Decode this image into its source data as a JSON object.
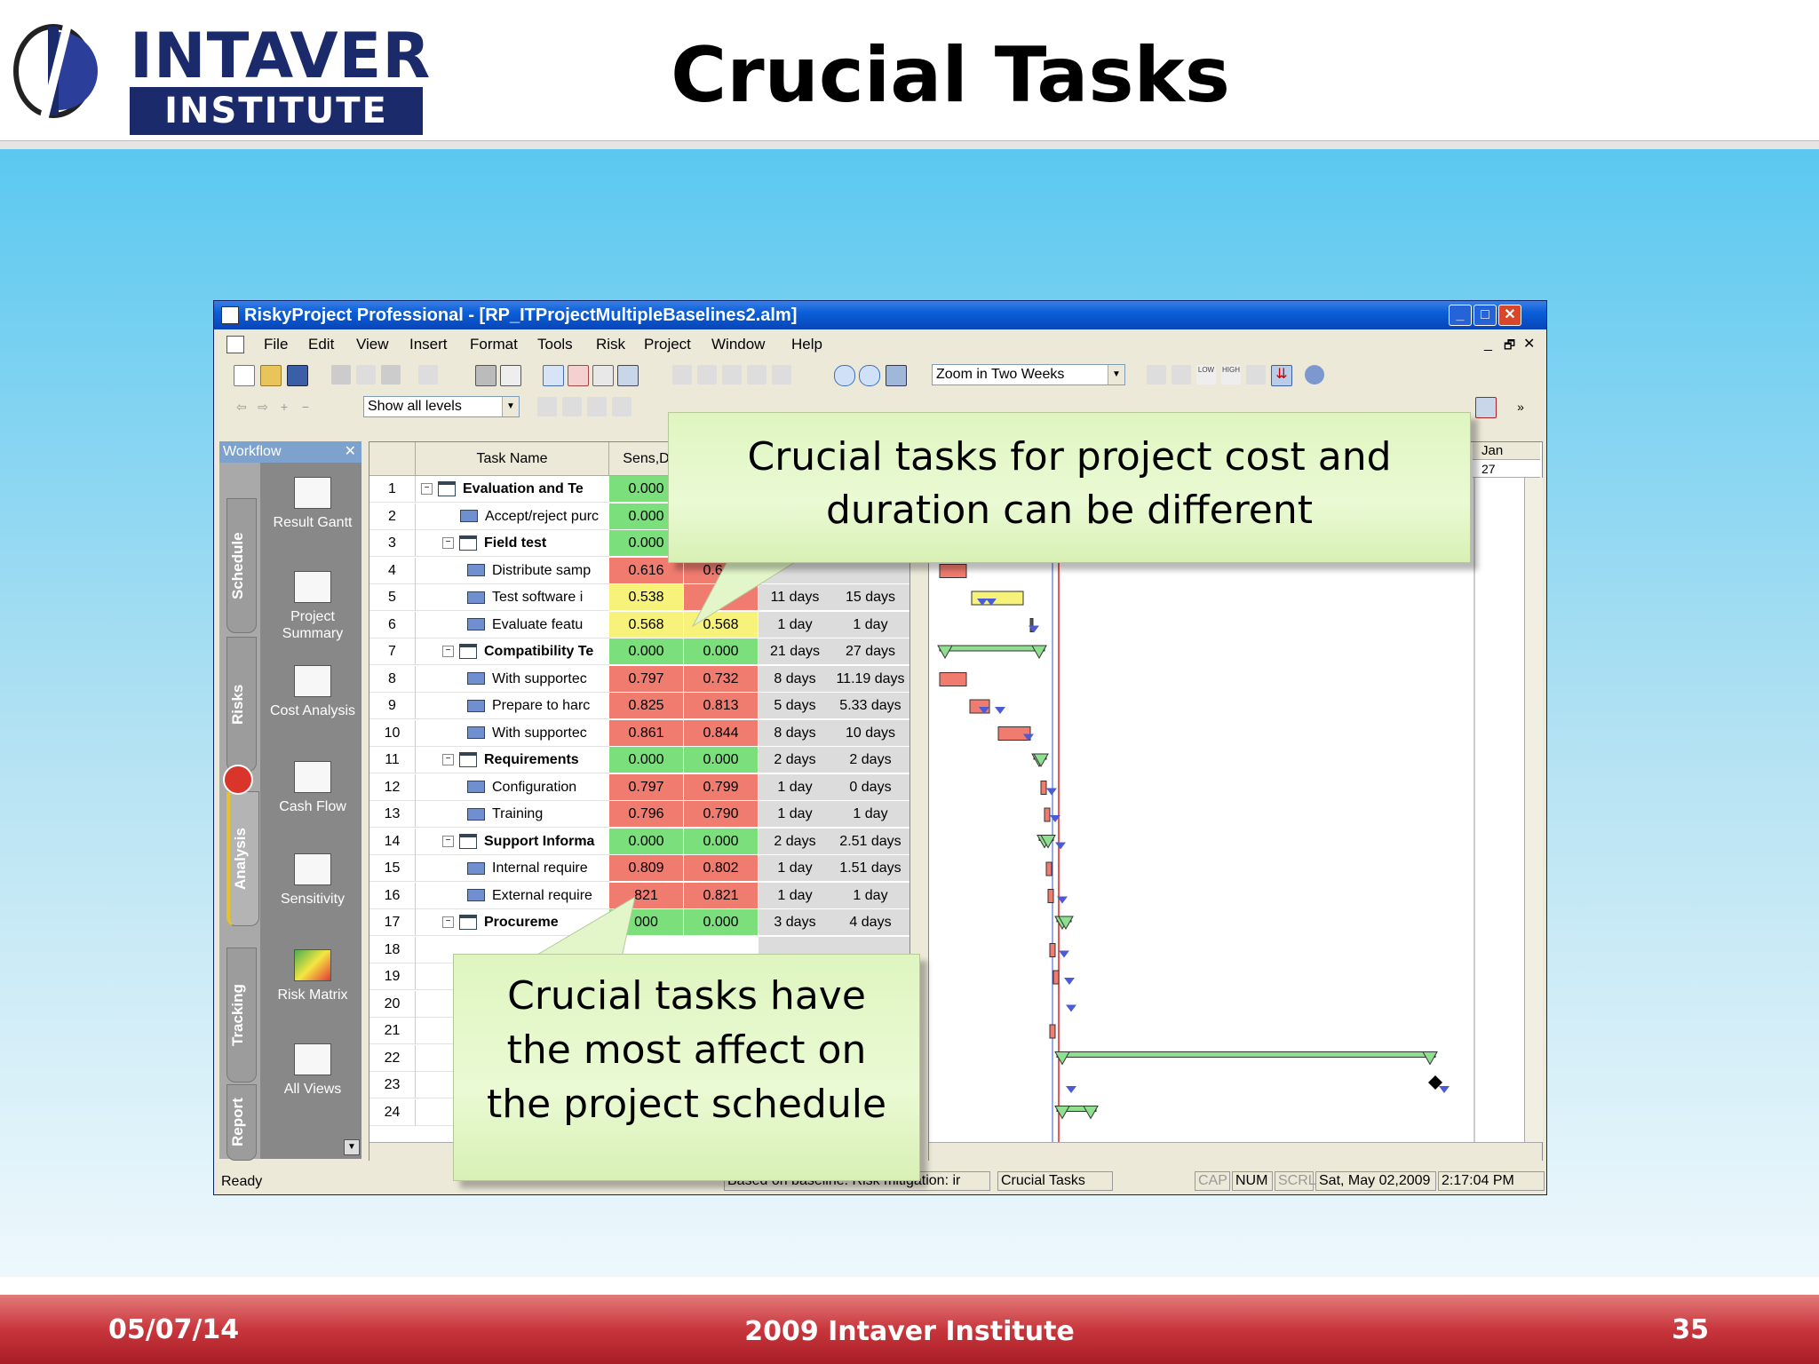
{
  "slide": {
    "logo_line1": "INTAVER",
    "logo_line2": "INSTITUTE",
    "title": "Crucial Tasks",
    "footer_date": "05/07/14",
    "footer_center": "2009 Intaver Institute",
    "page_number": "35"
  },
  "window": {
    "title": "RiskyProject Professional - [RP_ITProjectMultipleBaselines2.alm]",
    "menu": [
      "File",
      "Edit",
      "View",
      "Insert",
      "Format",
      "Tools",
      "Risk",
      "Project",
      "Window",
      "Help"
    ],
    "zoom_select": "Zoom in Two Weeks",
    "levels_select": "Show all levels",
    "status_ready": "Ready",
    "status_baseline": "Based on baseline.  Risk mitigation: ir",
    "status_view": "Crucial Tasks",
    "status_cap": "CAP",
    "status_num": "NUM",
    "status_scrl": "SCRL",
    "status_date": "Sat, May 02,2009",
    "status_time": "2:17:04 PM"
  },
  "workflow": {
    "header": "Workflow",
    "tabs": [
      "Schedule",
      "Risks",
      "Analysis",
      "Tracking",
      "Report"
    ],
    "items": [
      "Result Gantt",
      "Project Summary",
      "Cost Analysis",
      "Cash Flow",
      "Sensitivity",
      "Risk Matrix",
      "All Views"
    ]
  },
  "grid": {
    "col_name": "Task Name",
    "col_sens": "Sens,D",
    "rows": [
      {
        "id": "1",
        "name": "Evaluation and Te",
        "v1": "0.000",
        "v2": "",
        "d1": "",
        "d2": ""
      },
      {
        "id": "2",
        "name": "Accept/reject purc",
        "v1": "0.000",
        "v2": "",
        "d1": "",
        "d2": ""
      },
      {
        "id": "3",
        "name": "Field test",
        "v1": "0.000",
        "v2": "",
        "d1": "",
        "d2": ""
      },
      {
        "id": "4",
        "name": "Distribute samp",
        "v1": "0.616",
        "v2": "0.660",
        "d1": "",
        "d2": ""
      },
      {
        "id": "5",
        "name": "Test software i",
        "v1": "0.538",
        "v2": "0.6",
        "d1": "11 days",
        "d2": "15 days"
      },
      {
        "id": "6",
        "name": "Evaluate featu",
        "v1": "0.568",
        "v2": "0.568",
        "d1": "1 day",
        "d2": "1 day"
      },
      {
        "id": "7",
        "name": "Compatibility Te",
        "v1": "0.000",
        "v2": "0.000",
        "d1": "21 days",
        "d2": "27 days"
      },
      {
        "id": "8",
        "name": "With supportec",
        "v1": "0.797",
        "v2": "0.732",
        "d1": "8 days",
        "d2": "11.19 days"
      },
      {
        "id": "9",
        "name": "Prepare to harc",
        "v1": "0.825",
        "v2": "0.813",
        "d1": "5 days",
        "d2": "5.33 days"
      },
      {
        "id": "10",
        "name": "With supportec",
        "v1": "0.861",
        "v2": "0.844",
        "d1": "8 days",
        "d2": "10 days"
      },
      {
        "id": "11",
        "name": "Requirements",
        "v1": "0.000",
        "v2": "0.000",
        "d1": "2 days",
        "d2": "2 days"
      },
      {
        "id": "12",
        "name": "Configuration",
        "v1": "0.797",
        "v2": "0.799",
        "d1": "1 day",
        "d2": "0 days"
      },
      {
        "id": "13",
        "name": "Training",
        "v1": "0.796",
        "v2": "0.790",
        "d1": "1 day",
        "d2": "1 day"
      },
      {
        "id": "14",
        "name": "Support Informa",
        "v1": "0.000",
        "v2": "0.000",
        "d1": "2 days",
        "d2": "2.51 days"
      },
      {
        "id": "15",
        "name": "Internal require",
        "v1": "0.809",
        "v2": "0.802",
        "d1": "1 day",
        "d2": "1.51 days"
      },
      {
        "id": "16",
        "name": "External require",
        "v1": "821",
        "v2": "0.821",
        "d1": "1 day",
        "d2": "1 day"
      },
      {
        "id": "17",
        "name": "Procureme",
        "v1": "000",
        "v2": "0.000",
        "d1": "3 days",
        "d2": "4 days"
      },
      {
        "id": "18",
        "name": "",
        "v1": "",
        "v2": "",
        "d1": "",
        "d2": ""
      },
      {
        "id": "19",
        "name": "",
        "v1": "",
        "v2": "",
        "d1": "",
        "d2": ""
      },
      {
        "id": "20",
        "name": "",
        "v1": "",
        "v2": "",
        "d1": "",
        "d2": ""
      },
      {
        "id": "21",
        "name": "",
        "v1": "",
        "v2": "",
        "d1": "",
        "d2": ""
      },
      {
        "id": "22",
        "name": "",
        "v1": "",
        "v2": "",
        "d1": "",
        "d2": ""
      },
      {
        "id": "23",
        "name": "",
        "v1": "",
        "v2": "",
        "d1": "",
        "d2": ""
      },
      {
        "id": "24",
        "name": "",
        "v1": "",
        "v2": "",
        "d1": "",
        "d2": ""
      }
    ]
  },
  "gantt": {
    "month_label": "Jan",
    "day_label": "27"
  },
  "callouts": {
    "top": "Crucial tasks for project cost and duration can be different",
    "bottom": "Crucial tasks have the most affect on the project schedule"
  }
}
